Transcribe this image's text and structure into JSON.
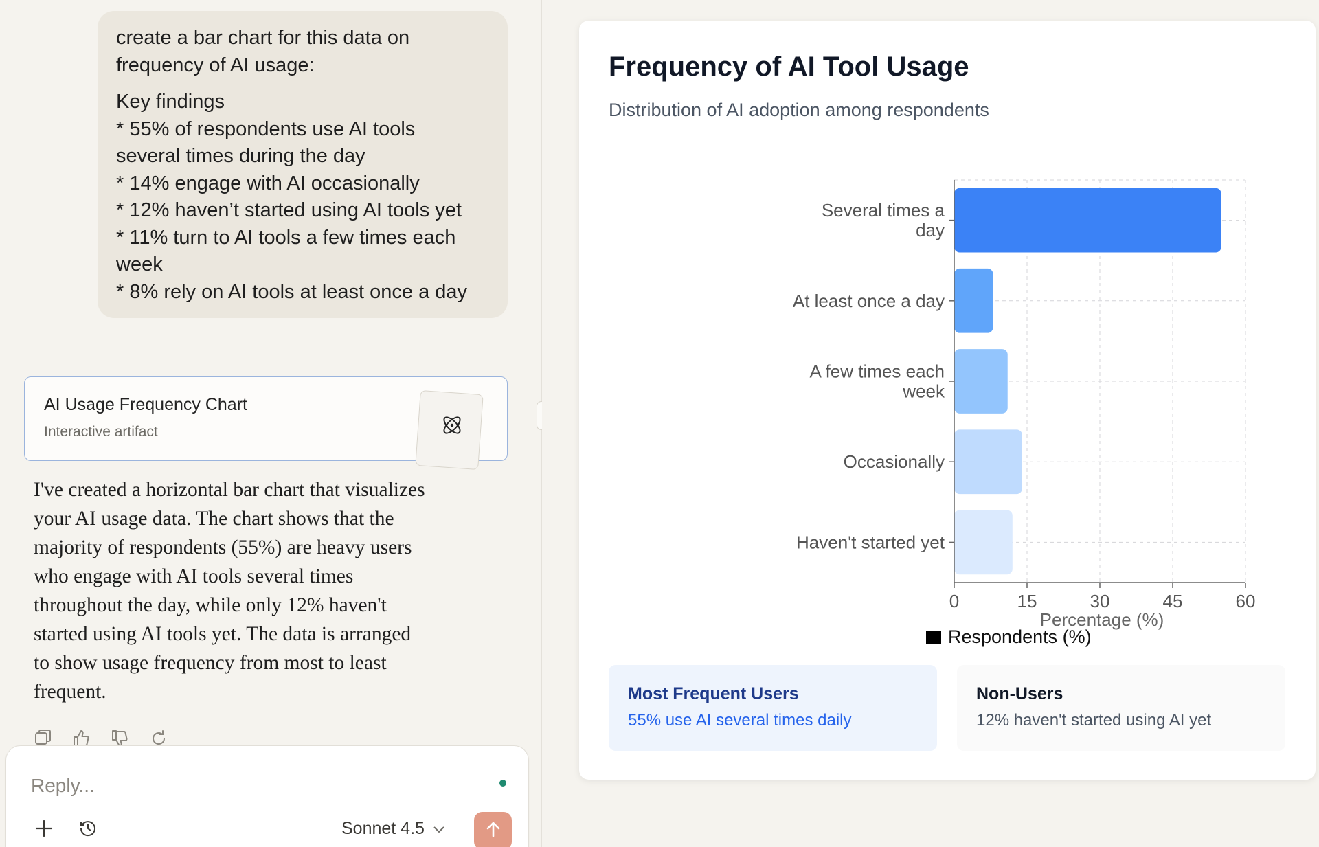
{
  "chat": {
    "user_message": {
      "lines": [
        "create a bar chart for this data on",
        "frequency of AI usage:",
        "",
        "Key findings",
        "* 55% of respondents use AI tools",
        "several times during the day",
        "* 14% engage with AI occasionally",
        "* 12% haven’t started using AI tools yet",
        "* 11% turn to AI tools a few times each",
        "week",
        "* 8% rely on AI tools at least once a day"
      ]
    },
    "artifact": {
      "title": "AI Usage Frequency Chart",
      "subtitle": "Interactive artifact",
      "icon": "atom-icon"
    },
    "assistant_message": {
      "lines": [
        "I've created a horizontal bar chart that visualizes",
        "your AI usage data. The chart shows that the",
        "majority of respondents (55%) are heavy users",
        "who engage with AI tools several times",
        "throughout the day, while only 12% haven't",
        "started using AI tools yet. The data is arranged",
        "to show usage frequency from most to least",
        "frequent."
      ]
    },
    "actions": [
      "copy-icon",
      "thumbs-up-icon",
      "thumbs-down-icon",
      "retry-icon"
    ]
  },
  "composer": {
    "placeholder": "Reply...",
    "model": "Sonnet 4.5",
    "send_color": "#e29a85"
  },
  "chart_data": {
    "type": "bar",
    "orientation": "horizontal",
    "title": "Frequency of AI Tool Usage",
    "subtitle": "Distribution of AI adoption among respondents",
    "categories": [
      "Several times a day",
      "At least once a day",
      "A few times each week",
      "Occasionally",
      "Haven't started yet"
    ],
    "category_lines": [
      [
        "Several times a",
        "day"
      ],
      [
        "At least once a day"
      ],
      [
        "A few times each",
        "week"
      ],
      [
        "Occasionally"
      ],
      [
        "Haven't started yet"
      ]
    ],
    "series": [
      {
        "name": "Respondents (%)",
        "values": [
          55,
          8,
          11,
          14,
          12
        ]
      }
    ],
    "bar_colors": [
      "#3b82f6",
      "#60a5fa",
      "#93c5fd",
      "#bfdbfe",
      "#dbeafe"
    ],
    "xlabel": "Percentage (%)",
    "ylabel": "",
    "xlim": [
      0,
      60
    ],
    "xticks": [
      0,
      15,
      30,
      45,
      60
    ],
    "grid": true,
    "legend": "bottom"
  },
  "summary_cards": {
    "frequent": {
      "heading": "Most Frequent Users",
      "text": "55% use AI several times daily"
    },
    "nonusers": {
      "heading": "Non-Users",
      "text": "12% haven't started using AI yet"
    }
  }
}
